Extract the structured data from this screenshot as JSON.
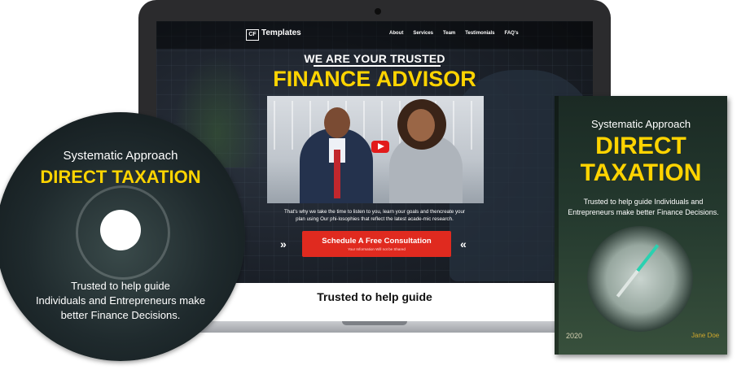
{
  "site": {
    "logo_mark": "CF",
    "logo_text": "Templates",
    "nav": [
      "About",
      "Services",
      "Team",
      "Testimonials",
      "FAQ's"
    ],
    "headline_top": "WE ARE YOUR TRUSTED",
    "headline_main": "FINANCE ADVISOR",
    "body_line_1": "That's why we take the time to listen to you, learn your goals and thencreate your",
    "body_line_2": "plan using Our phi-losophies that reflect the latest acade-mic research.",
    "cta_label": "Schedule A Free Consultation",
    "cta_sub": "Your Information Will not be Shared",
    "chevrons_left": "»",
    "chevrons_right": "«",
    "section_title": "Trusted to help guide"
  },
  "disc": {
    "top": "Systematic Approach",
    "title": "DIRECT TAXATION",
    "bottom_1": "Trusted to help guide",
    "bottom_2": "Individuals and Entrepreneurs make",
    "bottom_3": "better Finance Decisions."
  },
  "book": {
    "top": "Systematic Approach",
    "title_1": "DIRECT",
    "title_2": "TAXATION",
    "body_1": "Trusted to help guide Individuals and",
    "body_2": "Entrepreneurs make better Finance Decisions.",
    "year": "2020",
    "author": "Jane Doe"
  },
  "colors": {
    "accent_yellow": "#ffd400",
    "cta_red": "#e02a1f"
  }
}
